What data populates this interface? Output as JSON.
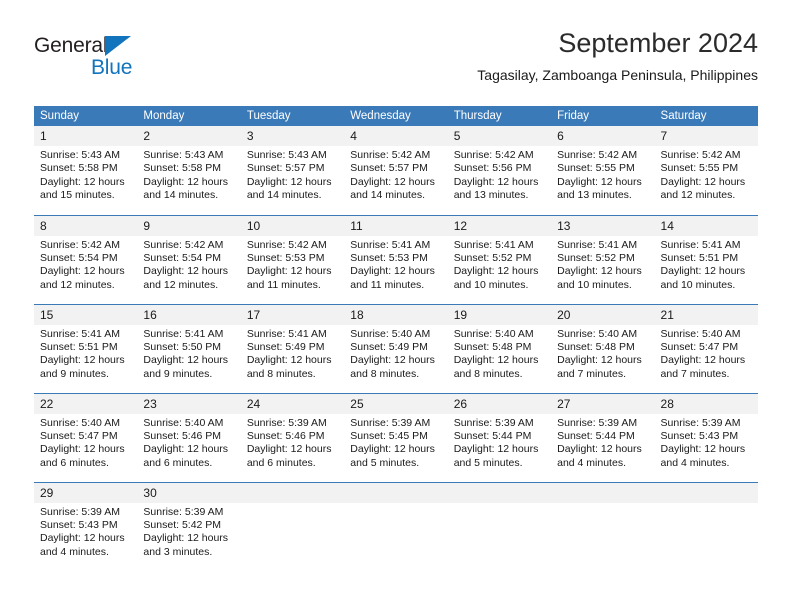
{
  "brand": {
    "name_top": "General",
    "name_bottom": "Blue",
    "accent_color": "#1274bd",
    "text_color": "#231f20"
  },
  "header": {
    "title": "September 2024",
    "subtitle": "Tagasilay, Zamboanga Peninsula, Philippines"
  },
  "theme": {
    "header_blue": "#3b7ab8",
    "daynum_band": "#f2f2f2",
    "body_background": "#ffffff"
  },
  "calendar": {
    "weekday_headers": [
      "Sunday",
      "Monday",
      "Tuesday",
      "Wednesday",
      "Thursday",
      "Friday",
      "Saturday"
    ],
    "weeks": [
      [
        {
          "day": "1",
          "sunrise": "Sunrise: 5:43 AM",
          "sunset": "Sunset: 5:58 PM",
          "daylight_line1": "Daylight: 12 hours",
          "daylight_line2": "and 15 minutes."
        },
        {
          "day": "2",
          "sunrise": "Sunrise: 5:43 AM",
          "sunset": "Sunset: 5:58 PM",
          "daylight_line1": "Daylight: 12 hours",
          "daylight_line2": "and 14 minutes."
        },
        {
          "day": "3",
          "sunrise": "Sunrise: 5:43 AM",
          "sunset": "Sunset: 5:57 PM",
          "daylight_line1": "Daylight: 12 hours",
          "daylight_line2": "and 14 minutes."
        },
        {
          "day": "4",
          "sunrise": "Sunrise: 5:42 AM",
          "sunset": "Sunset: 5:57 PM",
          "daylight_line1": "Daylight: 12 hours",
          "daylight_line2": "and 14 minutes."
        },
        {
          "day": "5",
          "sunrise": "Sunrise: 5:42 AM",
          "sunset": "Sunset: 5:56 PM",
          "daylight_line1": "Daylight: 12 hours",
          "daylight_line2": "and 13 minutes."
        },
        {
          "day": "6",
          "sunrise": "Sunrise: 5:42 AM",
          "sunset": "Sunset: 5:55 PM",
          "daylight_line1": "Daylight: 12 hours",
          "daylight_line2": "and 13 minutes."
        },
        {
          "day": "7",
          "sunrise": "Sunrise: 5:42 AM",
          "sunset": "Sunset: 5:55 PM",
          "daylight_line1": "Daylight: 12 hours",
          "daylight_line2": "and 12 minutes."
        }
      ],
      [
        {
          "day": "8",
          "sunrise": "Sunrise: 5:42 AM",
          "sunset": "Sunset: 5:54 PM",
          "daylight_line1": "Daylight: 12 hours",
          "daylight_line2": "and 12 minutes."
        },
        {
          "day": "9",
          "sunrise": "Sunrise: 5:42 AM",
          "sunset": "Sunset: 5:54 PM",
          "daylight_line1": "Daylight: 12 hours",
          "daylight_line2": "and 12 minutes."
        },
        {
          "day": "10",
          "sunrise": "Sunrise: 5:42 AM",
          "sunset": "Sunset: 5:53 PM",
          "daylight_line1": "Daylight: 12 hours",
          "daylight_line2": "and 11 minutes."
        },
        {
          "day": "11",
          "sunrise": "Sunrise: 5:41 AM",
          "sunset": "Sunset: 5:53 PM",
          "daylight_line1": "Daylight: 12 hours",
          "daylight_line2": "and 11 minutes."
        },
        {
          "day": "12",
          "sunrise": "Sunrise: 5:41 AM",
          "sunset": "Sunset: 5:52 PM",
          "daylight_line1": "Daylight: 12 hours",
          "daylight_line2": "and 10 minutes."
        },
        {
          "day": "13",
          "sunrise": "Sunrise: 5:41 AM",
          "sunset": "Sunset: 5:52 PM",
          "daylight_line1": "Daylight: 12 hours",
          "daylight_line2": "and 10 minutes."
        },
        {
          "day": "14",
          "sunrise": "Sunrise: 5:41 AM",
          "sunset": "Sunset: 5:51 PM",
          "daylight_line1": "Daylight: 12 hours",
          "daylight_line2": "and 10 minutes."
        }
      ],
      [
        {
          "day": "15",
          "sunrise": "Sunrise: 5:41 AM",
          "sunset": "Sunset: 5:51 PM",
          "daylight_line1": "Daylight: 12 hours",
          "daylight_line2": "and 9 minutes."
        },
        {
          "day": "16",
          "sunrise": "Sunrise: 5:41 AM",
          "sunset": "Sunset: 5:50 PM",
          "daylight_line1": "Daylight: 12 hours",
          "daylight_line2": "and 9 minutes."
        },
        {
          "day": "17",
          "sunrise": "Sunrise: 5:41 AM",
          "sunset": "Sunset: 5:49 PM",
          "daylight_line1": "Daylight: 12 hours",
          "daylight_line2": "and 8 minutes."
        },
        {
          "day": "18",
          "sunrise": "Sunrise: 5:40 AM",
          "sunset": "Sunset: 5:49 PM",
          "daylight_line1": "Daylight: 12 hours",
          "daylight_line2": "and 8 minutes."
        },
        {
          "day": "19",
          "sunrise": "Sunrise: 5:40 AM",
          "sunset": "Sunset: 5:48 PM",
          "daylight_line1": "Daylight: 12 hours",
          "daylight_line2": "and 8 minutes."
        },
        {
          "day": "20",
          "sunrise": "Sunrise: 5:40 AM",
          "sunset": "Sunset: 5:48 PM",
          "daylight_line1": "Daylight: 12 hours",
          "daylight_line2": "and 7 minutes."
        },
        {
          "day": "21",
          "sunrise": "Sunrise: 5:40 AM",
          "sunset": "Sunset: 5:47 PM",
          "daylight_line1": "Daylight: 12 hours",
          "daylight_line2": "and 7 minutes."
        }
      ],
      [
        {
          "day": "22",
          "sunrise": "Sunrise: 5:40 AM",
          "sunset": "Sunset: 5:47 PM",
          "daylight_line1": "Daylight: 12 hours",
          "daylight_line2": "and 6 minutes."
        },
        {
          "day": "23",
          "sunrise": "Sunrise: 5:40 AM",
          "sunset": "Sunset: 5:46 PM",
          "daylight_line1": "Daylight: 12 hours",
          "daylight_line2": "and 6 minutes."
        },
        {
          "day": "24",
          "sunrise": "Sunrise: 5:39 AM",
          "sunset": "Sunset: 5:46 PM",
          "daylight_line1": "Daylight: 12 hours",
          "daylight_line2": "and 6 minutes."
        },
        {
          "day": "25",
          "sunrise": "Sunrise: 5:39 AM",
          "sunset": "Sunset: 5:45 PM",
          "daylight_line1": "Daylight: 12 hours",
          "daylight_line2": "and 5 minutes."
        },
        {
          "day": "26",
          "sunrise": "Sunrise: 5:39 AM",
          "sunset": "Sunset: 5:44 PM",
          "daylight_line1": "Daylight: 12 hours",
          "daylight_line2": "and 5 minutes."
        },
        {
          "day": "27",
          "sunrise": "Sunrise: 5:39 AM",
          "sunset": "Sunset: 5:44 PM",
          "daylight_line1": "Daylight: 12 hours",
          "daylight_line2": "and 4 minutes."
        },
        {
          "day": "28",
          "sunrise": "Sunrise: 5:39 AM",
          "sunset": "Sunset: 5:43 PM",
          "daylight_line1": "Daylight: 12 hours",
          "daylight_line2": "and 4 minutes."
        }
      ],
      [
        {
          "day": "29",
          "sunrise": "Sunrise: 5:39 AM",
          "sunset": "Sunset: 5:43 PM",
          "daylight_line1": "Daylight: 12 hours",
          "daylight_line2": "and 4 minutes."
        },
        {
          "day": "30",
          "sunrise": "Sunrise: 5:39 AM",
          "sunset": "Sunset: 5:42 PM",
          "daylight_line1": "Daylight: 12 hours",
          "daylight_line2": "and 3 minutes."
        },
        {
          "day": "",
          "sunrise": "",
          "sunset": "",
          "daylight_line1": "",
          "daylight_line2": ""
        },
        {
          "day": "",
          "sunrise": "",
          "sunset": "",
          "daylight_line1": "",
          "daylight_line2": ""
        },
        {
          "day": "",
          "sunrise": "",
          "sunset": "",
          "daylight_line1": "",
          "daylight_line2": ""
        },
        {
          "day": "",
          "sunrise": "",
          "sunset": "",
          "daylight_line1": "",
          "daylight_line2": ""
        },
        {
          "day": "",
          "sunrise": "",
          "sunset": "",
          "daylight_line1": "",
          "daylight_line2": ""
        }
      ]
    ]
  }
}
